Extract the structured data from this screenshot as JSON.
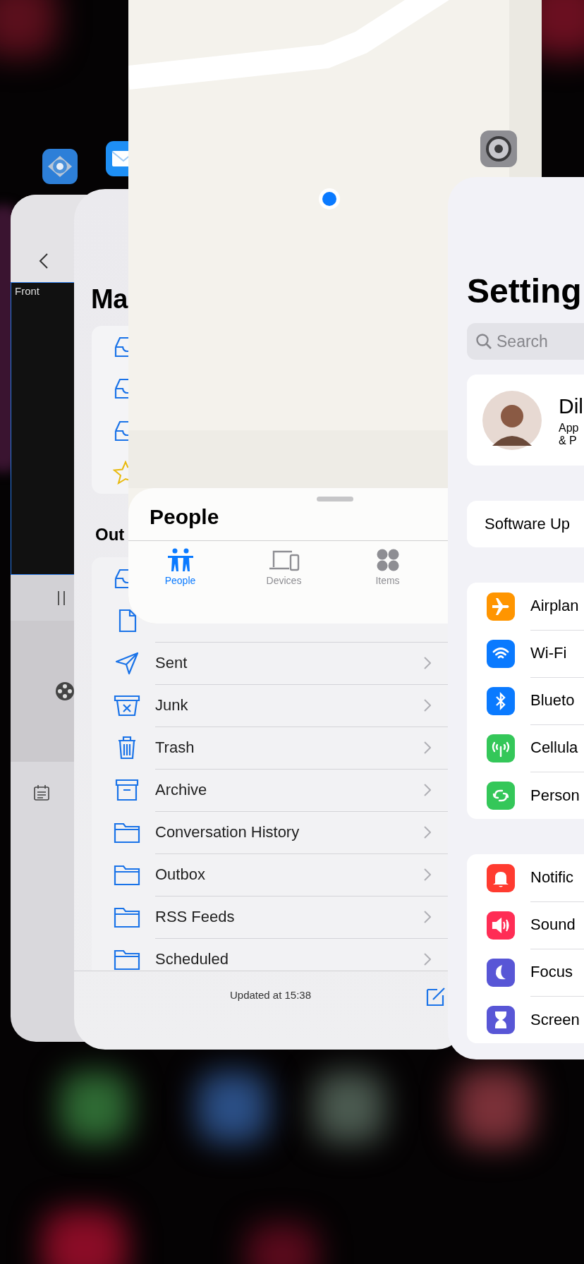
{
  "camera_app": {
    "preview_label": "Front"
  },
  "mail": {
    "title": "Ma",
    "section_header": "Out",
    "folders": [
      {
        "kind": "inbox"
      },
      {
        "kind": "draft"
      },
      {
        "kind": "sent",
        "name": "Sent"
      },
      {
        "kind": "junk",
        "name": "Junk"
      },
      {
        "kind": "trash",
        "name": "Trash"
      },
      {
        "kind": "archive",
        "name": "Archive"
      },
      {
        "kind": "folder",
        "name": "Conversation History"
      },
      {
        "kind": "folder",
        "name": "Outbox"
      },
      {
        "kind": "folder",
        "name": "RSS Feeds"
      },
      {
        "kind": "folder",
        "name": "Scheduled"
      }
    ],
    "status": "Updated at 15:38"
  },
  "find_my": {
    "sheet_title": "People",
    "tabs": [
      {
        "kind": "people",
        "label": "People",
        "selected": true
      },
      {
        "kind": "devices",
        "label": "Devices",
        "selected": false
      },
      {
        "kind": "items",
        "label": "Items",
        "selected": false
      }
    ]
  },
  "settings": {
    "title": "Setting",
    "search": {
      "placeholder": "Search"
    },
    "profile": {
      "name": "Dil",
      "subtitle": [
        "App",
        "& P"
      ]
    },
    "software_update": "Software Up",
    "groups": [
      [
        {
          "kind": "airplane",
          "label": "Airplan",
          "color": "#ff9500"
        },
        {
          "kind": "wifi",
          "label": "Wi-Fi",
          "color": "#0a7aff"
        },
        {
          "kind": "bluetooth",
          "label": "Blueto",
          "color": "#0a7aff"
        },
        {
          "kind": "cellular",
          "label": "Cellula",
          "color": "#34c759"
        },
        {
          "kind": "hotspot",
          "label": "Person",
          "color": "#34c759"
        }
      ],
      [
        {
          "kind": "bell",
          "label": "Notific",
          "color": "#ff3b30"
        },
        {
          "kind": "speaker",
          "label": "Sound",
          "color": "#ff2d55"
        },
        {
          "kind": "moon",
          "label": "Focus",
          "color": "#5856d6"
        },
        {
          "kind": "hourglass",
          "label": "Screen",
          "color": "#5856d6"
        }
      ]
    ]
  }
}
